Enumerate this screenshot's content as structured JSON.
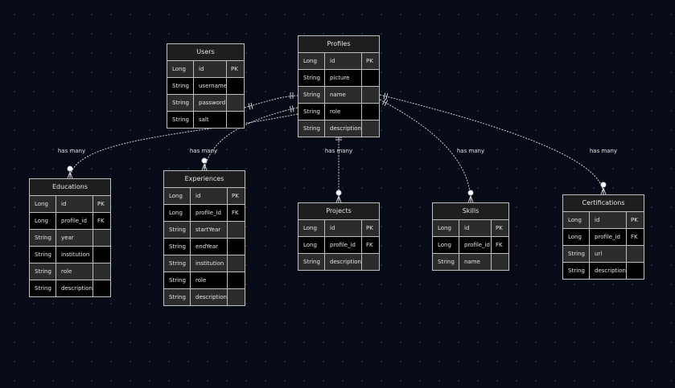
{
  "entities": [
    {
      "id": "users",
      "title": "Users",
      "rows": [
        {
          "type": "Long",
          "name": "id",
          "key": "PK"
        },
        {
          "type": "String",
          "name": "username",
          "key": ""
        },
        {
          "type": "String",
          "name": "password",
          "key": ""
        },
        {
          "type": "String",
          "name": "salt",
          "key": ""
        }
      ]
    },
    {
      "id": "profiles",
      "title": "Profiles",
      "rows": [
        {
          "type": "Long",
          "name": "id",
          "key": "PK"
        },
        {
          "type": "String",
          "name": "picture",
          "key": ""
        },
        {
          "type": "String",
          "name": "name",
          "key": ""
        },
        {
          "type": "String",
          "name": "role",
          "key": ""
        },
        {
          "type": "String",
          "name": "description",
          "key": ""
        }
      ]
    },
    {
      "id": "educations",
      "title": "Educations",
      "rows": [
        {
          "type": "Long",
          "name": "id",
          "key": "PK"
        },
        {
          "type": "Long",
          "name": "profile_id",
          "key": "FK"
        },
        {
          "type": "String",
          "name": "year",
          "key": ""
        },
        {
          "type": "String",
          "name": "institution",
          "key": ""
        },
        {
          "type": "String",
          "name": "role",
          "key": ""
        },
        {
          "type": "String",
          "name": "description",
          "key": ""
        }
      ]
    },
    {
      "id": "experiences",
      "title": "Experiences",
      "rows": [
        {
          "type": "Long",
          "name": "id",
          "key": "PK"
        },
        {
          "type": "Long",
          "name": "profile_id",
          "key": "FK"
        },
        {
          "type": "String",
          "name": "startYear",
          "key": ""
        },
        {
          "type": "String",
          "name": "endYear",
          "key": ""
        },
        {
          "type": "String",
          "name": "institution",
          "key": ""
        },
        {
          "type": "String",
          "name": "role",
          "key": ""
        },
        {
          "type": "String",
          "name": "description",
          "key": ""
        }
      ]
    },
    {
      "id": "projects",
      "title": "Projects",
      "rows": [
        {
          "type": "Long",
          "name": "id",
          "key": "PK"
        },
        {
          "type": "Long",
          "name": "profile_id",
          "key": "FK"
        },
        {
          "type": "String",
          "name": "description",
          "key": ""
        }
      ]
    },
    {
      "id": "skills",
      "title": "Skills",
      "rows": [
        {
          "type": "Long",
          "name": "id",
          "key": "PK"
        },
        {
          "type": "Long",
          "name": "profile_id",
          "key": "FK"
        },
        {
          "type": "String",
          "name": "name",
          "key": ""
        }
      ]
    },
    {
      "id": "certifications",
      "title": "Certifications",
      "rows": [
        {
          "type": "Long",
          "name": "id",
          "key": "PK"
        },
        {
          "type": "Long",
          "name": "profile_id",
          "key": "FK"
        },
        {
          "type": "String",
          "name": "url",
          "key": ""
        },
        {
          "type": "String",
          "name": "description",
          "key": ""
        }
      ]
    }
  ],
  "relationships": [
    {
      "from": "users",
      "to": "profiles",
      "label": ""
    },
    {
      "from": "profiles",
      "to": "educations",
      "label": "has many"
    },
    {
      "from": "profiles",
      "to": "experiences",
      "label": "has many"
    },
    {
      "from": "profiles",
      "to": "projects",
      "label": "has many"
    },
    {
      "from": "profiles",
      "to": "skills",
      "label": "has many"
    },
    {
      "from": "profiles",
      "to": "certifications",
      "label": "has many"
    }
  ],
  "colors": {
    "background": "#070b17",
    "line": "#cfcfcf",
    "border": "#bfbfbf",
    "title_bg": "#1e1e1e",
    "row_even": "#2c2c2c",
    "row_odd": "#000000",
    "text": "#e6e6e6"
  }
}
